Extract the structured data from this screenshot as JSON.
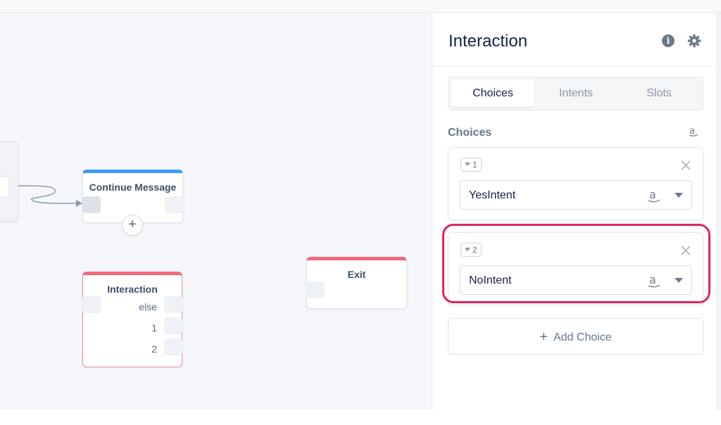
{
  "canvas": {
    "continue_block": {
      "title": "Continue Message"
    },
    "interaction_block": {
      "title": "Interaction",
      "rows": [
        "else",
        "1",
        "2"
      ]
    },
    "exit_block": {
      "title": "Exit"
    }
  },
  "panel": {
    "title": "Interaction",
    "tabs": [
      {
        "label": "Choices",
        "active": true
      },
      {
        "label": "Intents",
        "active": false
      },
      {
        "label": "Slots",
        "active": false
      }
    ],
    "section_label": "Choices",
    "choices": [
      {
        "badge": "1",
        "intent": "YesIntent"
      },
      {
        "badge": "2",
        "intent": "NoIntent"
      }
    ],
    "add_choice_label": "Add Choice"
  },
  "colors": {
    "accent_blue": "#3d9bf5",
    "accent_red": "#f2687c",
    "highlight": "#e0245e"
  }
}
